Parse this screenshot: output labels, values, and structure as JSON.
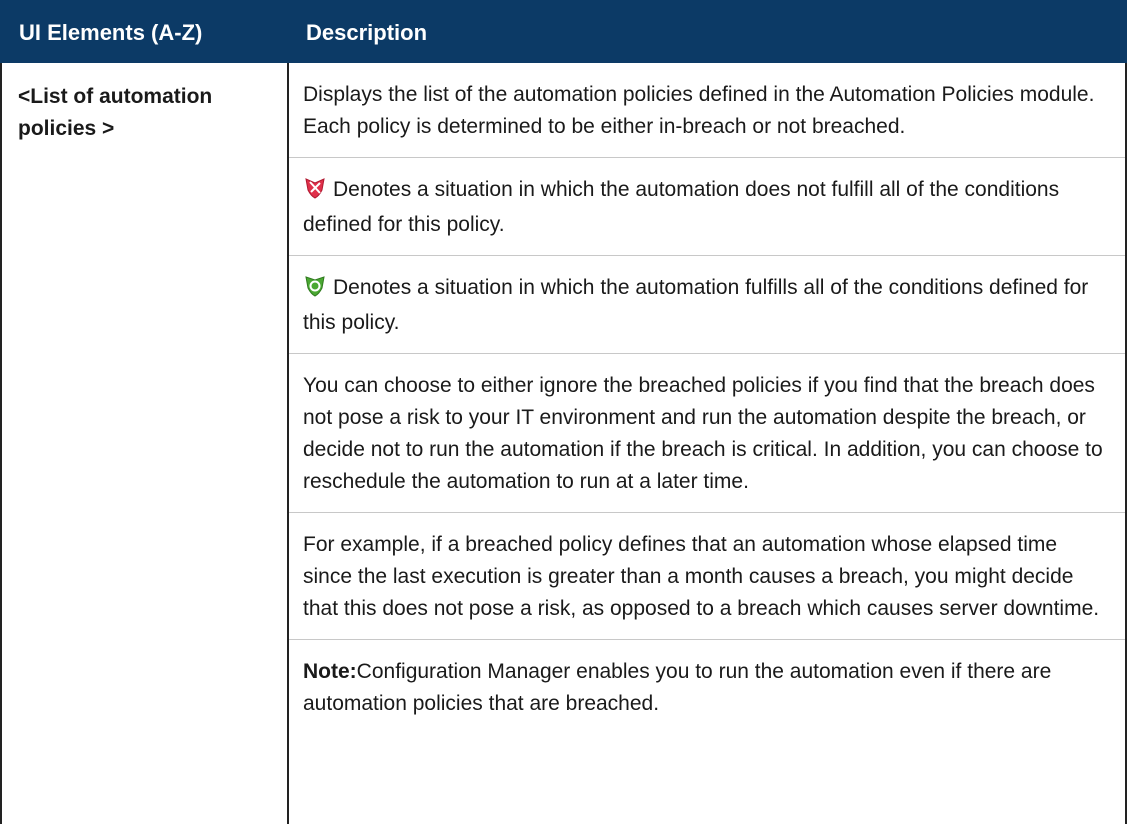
{
  "table": {
    "header": {
      "col1": "UI Elements (A-Z)",
      "col2": "Description"
    },
    "row": {
      "element": "<List of automation policies >",
      "paragraphs": {
        "intro": "Displays the list of the automation policies defined in the Automation Policies module. Each policy is determined to be either in-breach or not breached.",
        "breached": "Denotes a situation in which the automation does not fulfill all of the conditions defined for this policy.",
        "not_breached": "Denotes a situation in which the automation fulfills all of the conditions defined for this policy.",
        "choose": "You can choose to either ignore the breached policies if you find that the breach does not pose a risk to your IT environment and run the automation despite the breach, or decide not to run the automation if the breach is critical. In addition, you can choose to reschedule the automation to run at a later time.",
        "example": "For example, if a breached policy defines that an automation whose elapsed time since the last execution is greater than a month causes a breach, you might decide that this does not pose a risk, as opposed to a breach which causes server downtime.",
        "note_label": "Note:",
        "note_text": "Configuration Manager enables you to run the automation even if there are automation policies that are breached."
      }
    }
  },
  "icons": {
    "breached": "breached-policy-icon",
    "not_breached": "compliant-policy-icon"
  },
  "colors": {
    "header_bg": "#0c3a66",
    "header_text": "#ffffff",
    "breached_icon": "#e0304a",
    "compliant_icon": "#4aa832"
  }
}
